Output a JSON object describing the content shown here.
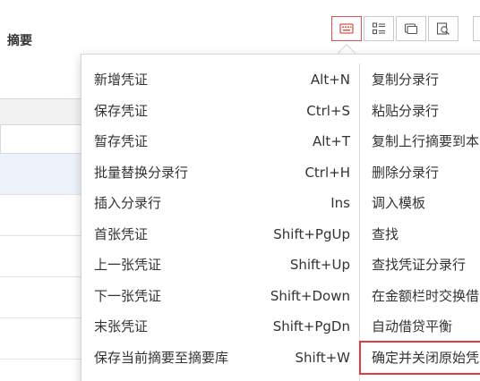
{
  "table": {
    "header_label": "摘要"
  },
  "toolbar": {
    "buttons": [
      {
        "icon": "keyboard-icon",
        "active": true
      },
      {
        "icon": "list-layout-icon",
        "active": false
      },
      {
        "icon": "window-icon",
        "active": false
      },
      {
        "icon": "search-preview-icon",
        "active": false
      }
    ],
    "accent_color": "#d9534f"
  },
  "menu": {
    "left": [
      {
        "label": "新增凭证",
        "shortcut": "Alt+N"
      },
      {
        "label": "保存凭证",
        "shortcut": "Ctrl+S"
      },
      {
        "label": "暂存凭证",
        "shortcut": "Alt+T"
      },
      {
        "label": "批量替换分录行",
        "shortcut": "Ctrl+H"
      },
      {
        "label": "插入分录行",
        "shortcut": "Ins"
      },
      {
        "label": "首张凭证",
        "shortcut": "Shift+PgUp"
      },
      {
        "label": "上一张凭证",
        "shortcut": "Shift+Up"
      },
      {
        "label": "下一张凭证",
        "shortcut": "Shift+Down"
      },
      {
        "label": "末张凭证",
        "shortcut": "Shift+PgDn"
      },
      {
        "label": "保存当前摘要至摘要库",
        "shortcut": "Shift+W"
      }
    ],
    "right": [
      {
        "label": "复制分录行"
      },
      {
        "label": "粘贴分录行"
      },
      {
        "label": "复制上行摘要到本"
      },
      {
        "label": "删除分录行"
      },
      {
        "label": "调入模板"
      },
      {
        "label": "查找"
      },
      {
        "label": "查找凭证分录行"
      },
      {
        "label": "在金额栏时交换借"
      },
      {
        "label": "自动借贷平衡"
      },
      {
        "label": "确定并关闭原始凭"
      }
    ],
    "highlight_color": "#e23c3c"
  }
}
